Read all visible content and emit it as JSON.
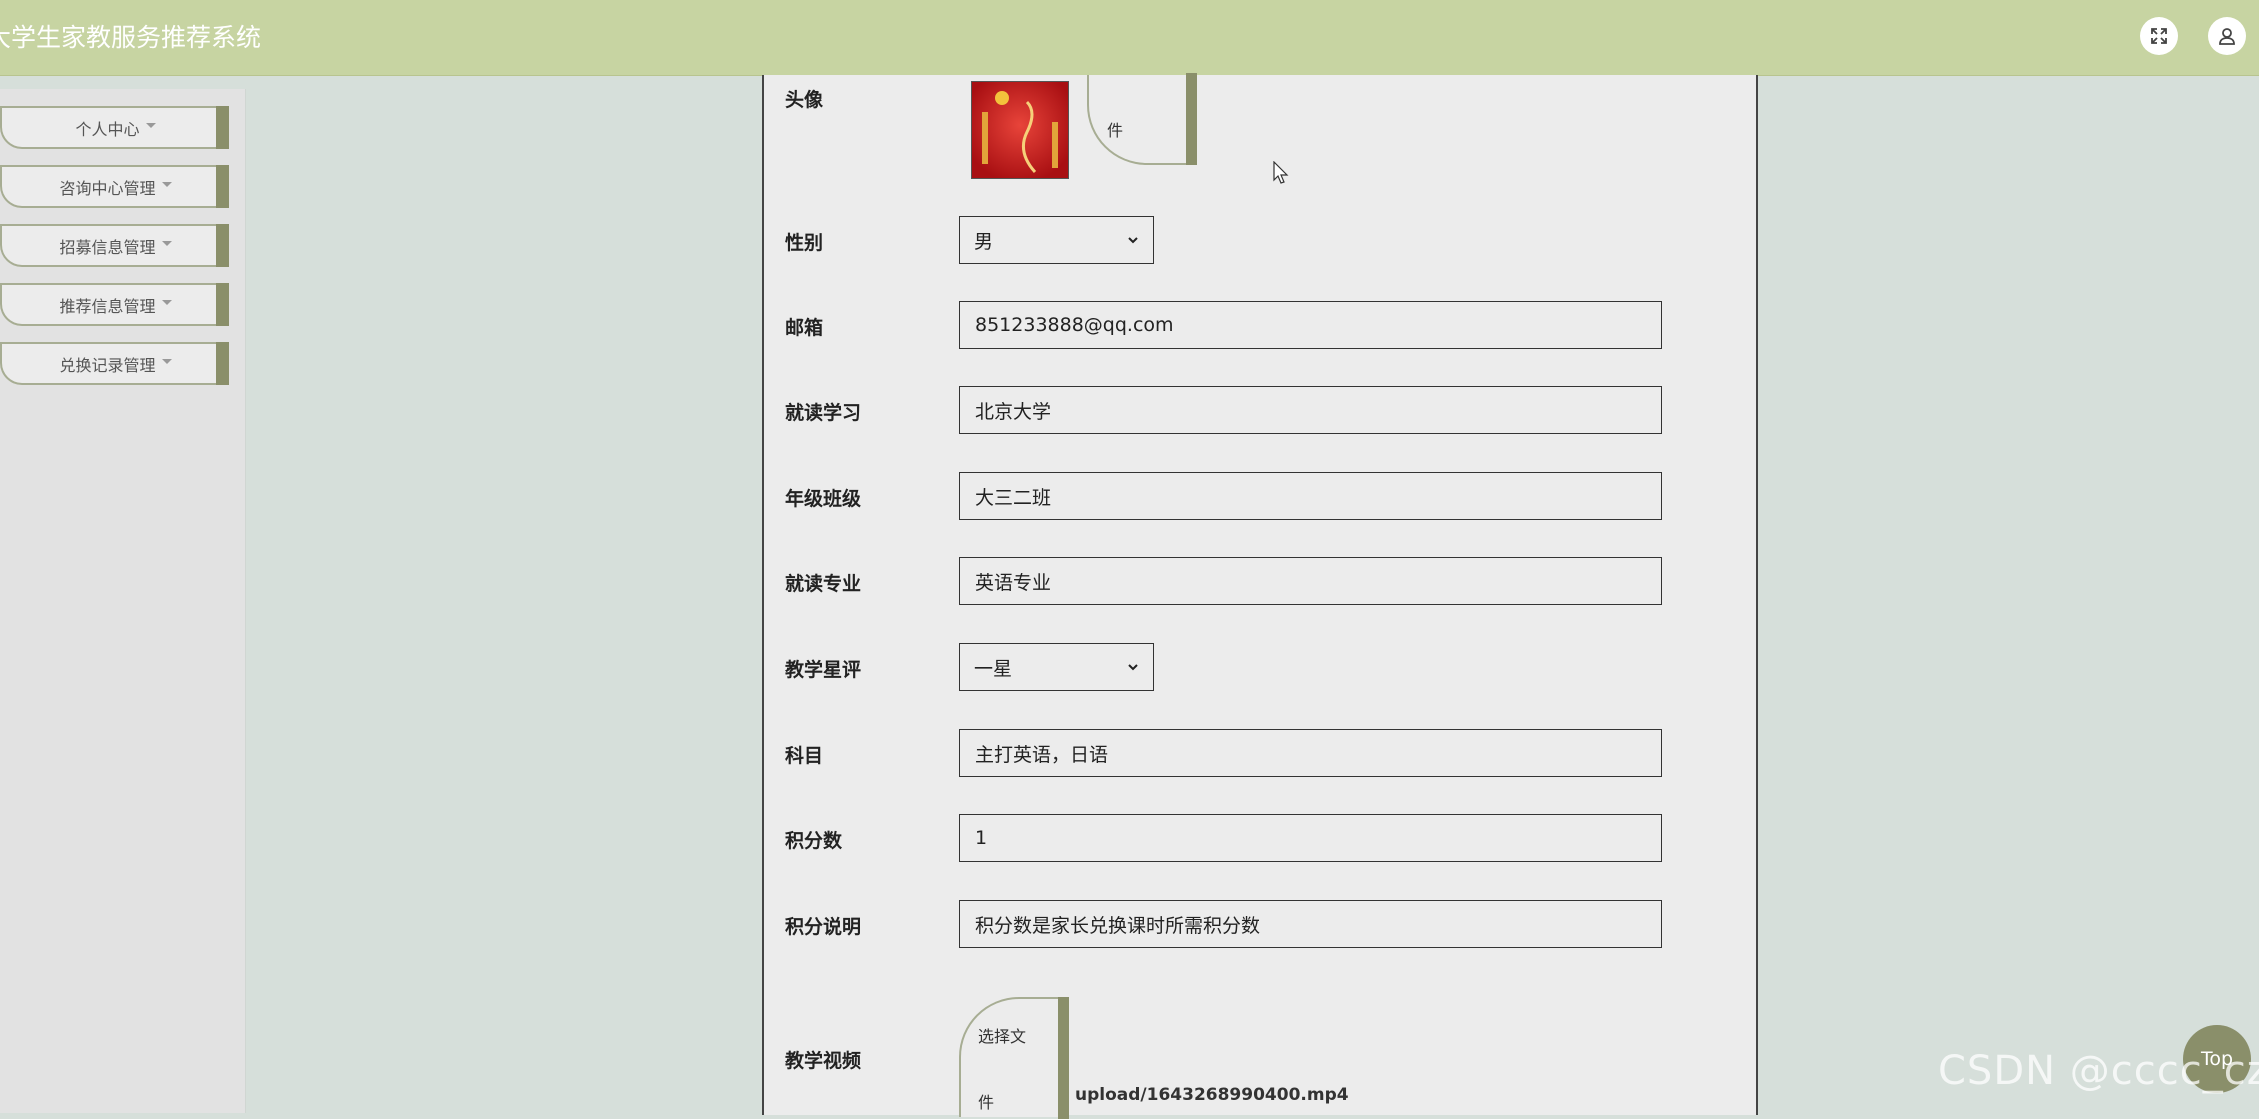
{
  "header": {
    "title": "大学生家教服务推荐系统",
    "fullscreen_icon": "fullscreen-icon",
    "user_icon": "user-icon"
  },
  "sidebar": {
    "items": [
      {
        "label": "个人中心"
      },
      {
        "label": "咨询中心管理"
      },
      {
        "label": "招募信息管理"
      },
      {
        "label": "推荐信息管理"
      },
      {
        "label": "兑换记录管理"
      }
    ]
  },
  "form": {
    "avatar": {
      "label": "头像",
      "file_button": "件"
    },
    "gender": {
      "label": "性别",
      "value": "男"
    },
    "email": {
      "label": "邮箱",
      "value": "851233888@qq.com"
    },
    "school": {
      "label": "就读学习",
      "value": "北京大学"
    },
    "grade_class": {
      "label": "年级班级",
      "value": "大三二班"
    },
    "major": {
      "label": "就读专业",
      "value": "英语专业"
    },
    "rating": {
      "label": "教学星评",
      "value": "一星"
    },
    "subject": {
      "label": "科目",
      "value": "主打英语，日语"
    },
    "points": {
      "label": "积分数",
      "value": "1"
    },
    "points_desc": {
      "label": "积分说明",
      "value": "积分数是家长兑换课时所需积分数"
    },
    "video": {
      "label": "教学视频",
      "file_button_line1": "选择文",
      "file_button_line2": "件",
      "file_name": "upload/1643268990400.mp4"
    }
  },
  "top_button": {
    "label": "Top"
  },
  "watermark": "CSDN @cccc_cz",
  "colors": {
    "header_bg": "#c7d4a2",
    "page_bg": "#d6dfda",
    "accent": "#8a8f6a",
    "panel_bg": "#ececec"
  }
}
